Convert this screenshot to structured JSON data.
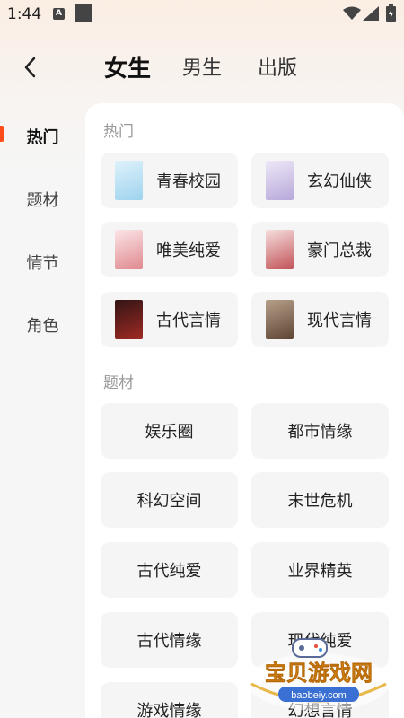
{
  "status_bar": {
    "time": "1:44",
    "a_icon": "A"
  },
  "tabs": [
    {
      "label": "女生",
      "active": true
    },
    {
      "label": "男生",
      "active": false
    },
    {
      "label": "出版",
      "active": false
    }
  ],
  "sidebar": {
    "items": [
      {
        "label": "热门",
        "active": true
      },
      {
        "label": "题材",
        "active": false
      },
      {
        "label": "情节",
        "active": false
      },
      {
        "label": "角色",
        "active": false
      }
    ]
  },
  "sections": [
    {
      "title": "热门",
      "items": [
        "青春校园",
        "玄幻仙侠",
        "唯美纯爱",
        "豪门总裁",
        "古代言情",
        "现代言情"
      ]
    },
    {
      "title": "题材",
      "items": [
        "娱乐圈",
        "都市情缘",
        "科幻空间",
        "末世危机",
        "古代纯爱",
        "业界精英",
        "古代情缘",
        "现代纯爱",
        "游戏情缘",
        "幻想言情"
      ]
    }
  ],
  "watermark": {
    "text": "宝贝游戏网",
    "url": "baobeiy.com"
  },
  "colors": {
    "accent": "#ff4d1a",
    "card_bg": "#f5f5f5",
    "section_title": "#999999"
  }
}
